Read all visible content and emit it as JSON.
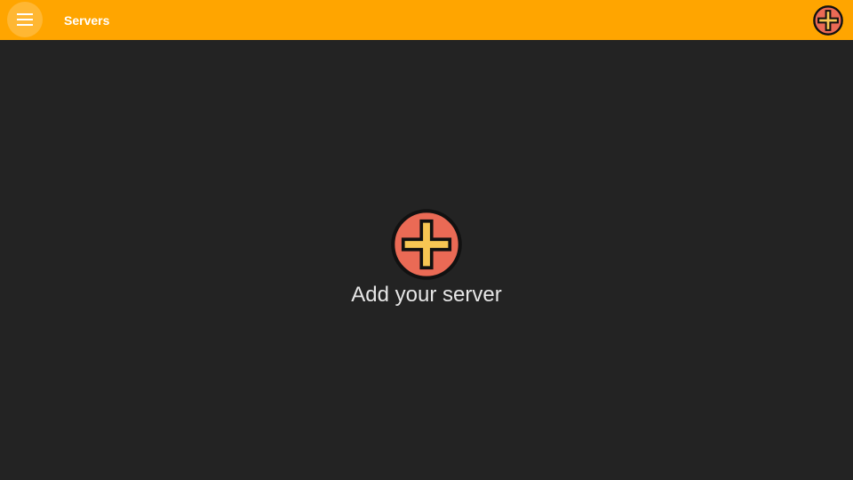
{
  "header": {
    "title": "Servers",
    "menu_icon": "hamburger-menu-icon",
    "add_icon": "add-circle-icon"
  },
  "main": {
    "empty_state": {
      "icon": "add-circle-icon",
      "label": "Add your server"
    }
  },
  "colors": {
    "header_background": "#ffa500",
    "page_background": "#232323",
    "add_icon_fill": "#ea6a55",
    "add_icon_cross": "#f7c653"
  }
}
